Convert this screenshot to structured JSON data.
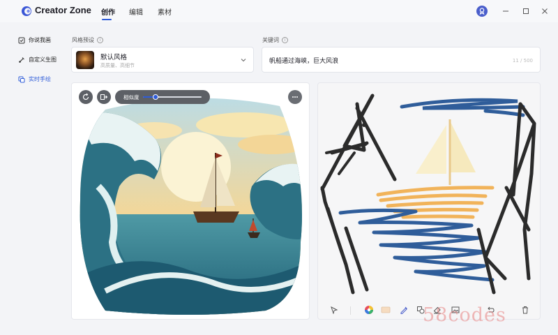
{
  "app": {
    "title": "Creator Zone"
  },
  "tabs": [
    {
      "label": "创作",
      "active": true
    },
    {
      "label": "编辑",
      "active": false
    },
    {
      "label": "素材",
      "active": false
    }
  ],
  "sidebar": {
    "items": [
      {
        "label": "你说我画",
        "icon": "draw-card-icon",
        "active": false
      },
      {
        "label": "自定义生图",
        "icon": "brush-icon",
        "active": false
      },
      {
        "label": "实时手绘",
        "icon": "realtime-sketch-icon",
        "active": true
      }
    ]
  },
  "style_preset": {
    "label": "风格预设",
    "selected": "默认风格",
    "subtitle": "高质量、高细节"
  },
  "keywords": {
    "label": "关键词",
    "value": "帆船通过海峡，巨大风浪",
    "count": "11 / 500"
  },
  "similarity": {
    "label": "相似度",
    "value": 0.22
  },
  "watermark": "58codes",
  "colors": {
    "accent": "#2e5bd8",
    "control_bg": "#5d6066"
  },
  "drawing_tools": [
    "select-arrow-icon",
    "color-wheel-icon",
    "color-swatch-icon",
    "pen-icon",
    "shape-icon",
    "eraser-icon",
    "image-icon",
    "undo-icon",
    "delete-icon"
  ]
}
